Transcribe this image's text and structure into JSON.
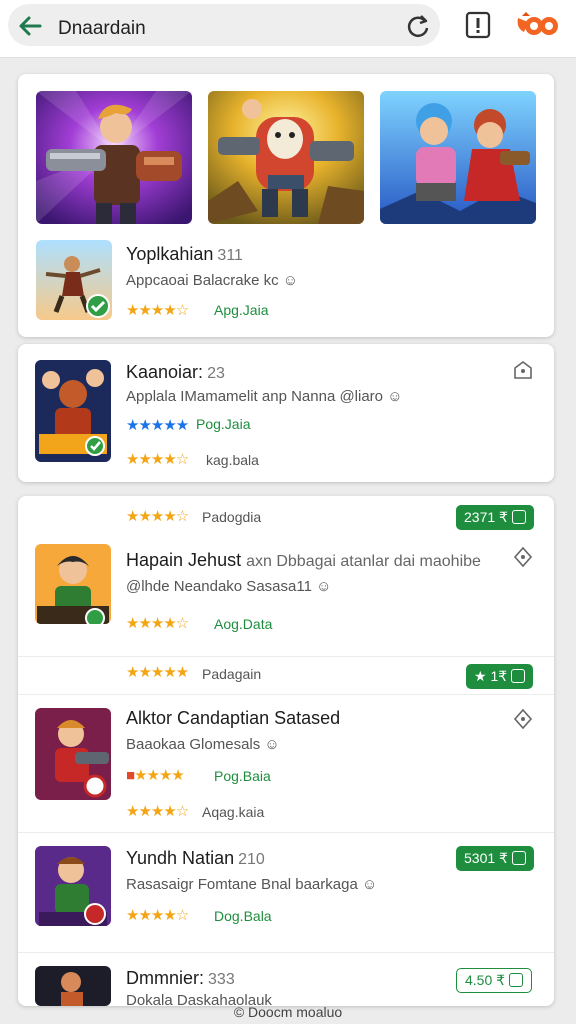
{
  "header": {
    "search_text": "Dnaardain",
    "icons": [
      "back-arrow-icon",
      "refresh-icon",
      "report-icon",
      "brand-logo-icon"
    ]
  },
  "featured": {
    "banners": [
      "banner-hero-gunner",
      "banner-robot-fighter",
      "banner-brawl-heroes"
    ],
    "app": {
      "title": "Yoplkahian",
      "num": "311",
      "subtitle": "Appcaoai Balacrake kc ☺",
      "stars": "★★★★☆",
      "link": "Apg.Jaia"
    }
  },
  "item2": {
    "title": "Kaanoiar:",
    "num": "23",
    "subtitle": "Applala IMamamelit anp Nanna @liaro ☺",
    "stars_blue": "★★★★★",
    "link1": "Pog.Jaia",
    "stars": "★★★★☆",
    "link2": "kag.bala"
  },
  "list": [
    {
      "top_stars": "★★★★☆",
      "top_label": "Padogdia",
      "badge": "2371 ₹",
      "title": "Hapain Jehust",
      "title_rest": "axn Dbbagai atanlar dai maohibe",
      "subtitle": "@lhde Neandako Sasasa11 ☺",
      "stars": "★★★★☆",
      "link": "Aog.Data"
    },
    {
      "top_stars": "★★★★★",
      "top_label": "Padagain",
      "badge": "★ 1₹",
      "title": "Alktor Candaptian Satased",
      "subtitle": "Baaokaa Glomesals ☺",
      "stars": "★★★★",
      "link": "Pog.Baia",
      "stars2": "★★★★☆",
      "link2": "Aqag.kaia"
    },
    {
      "title": "Yundh Natian",
      "num": "210",
      "badge": "5301 ₹",
      "subtitle": "Rasasaigr Fomtane Bnal baarkaga ☺",
      "stars": "★★★★☆",
      "link": "Dog.Bala"
    },
    {
      "title": "Dmmnier:",
      "num": "333",
      "badge": "4.50 ₹",
      "subtitle": "Dokala Daskahaolauk"
    }
  ],
  "footer": {
    "text": "© Doocm moaluo"
  },
  "colors": {
    "accent_green": "#1e8e3e",
    "star": "#f4a514",
    "brand_orange": "#f26522"
  }
}
